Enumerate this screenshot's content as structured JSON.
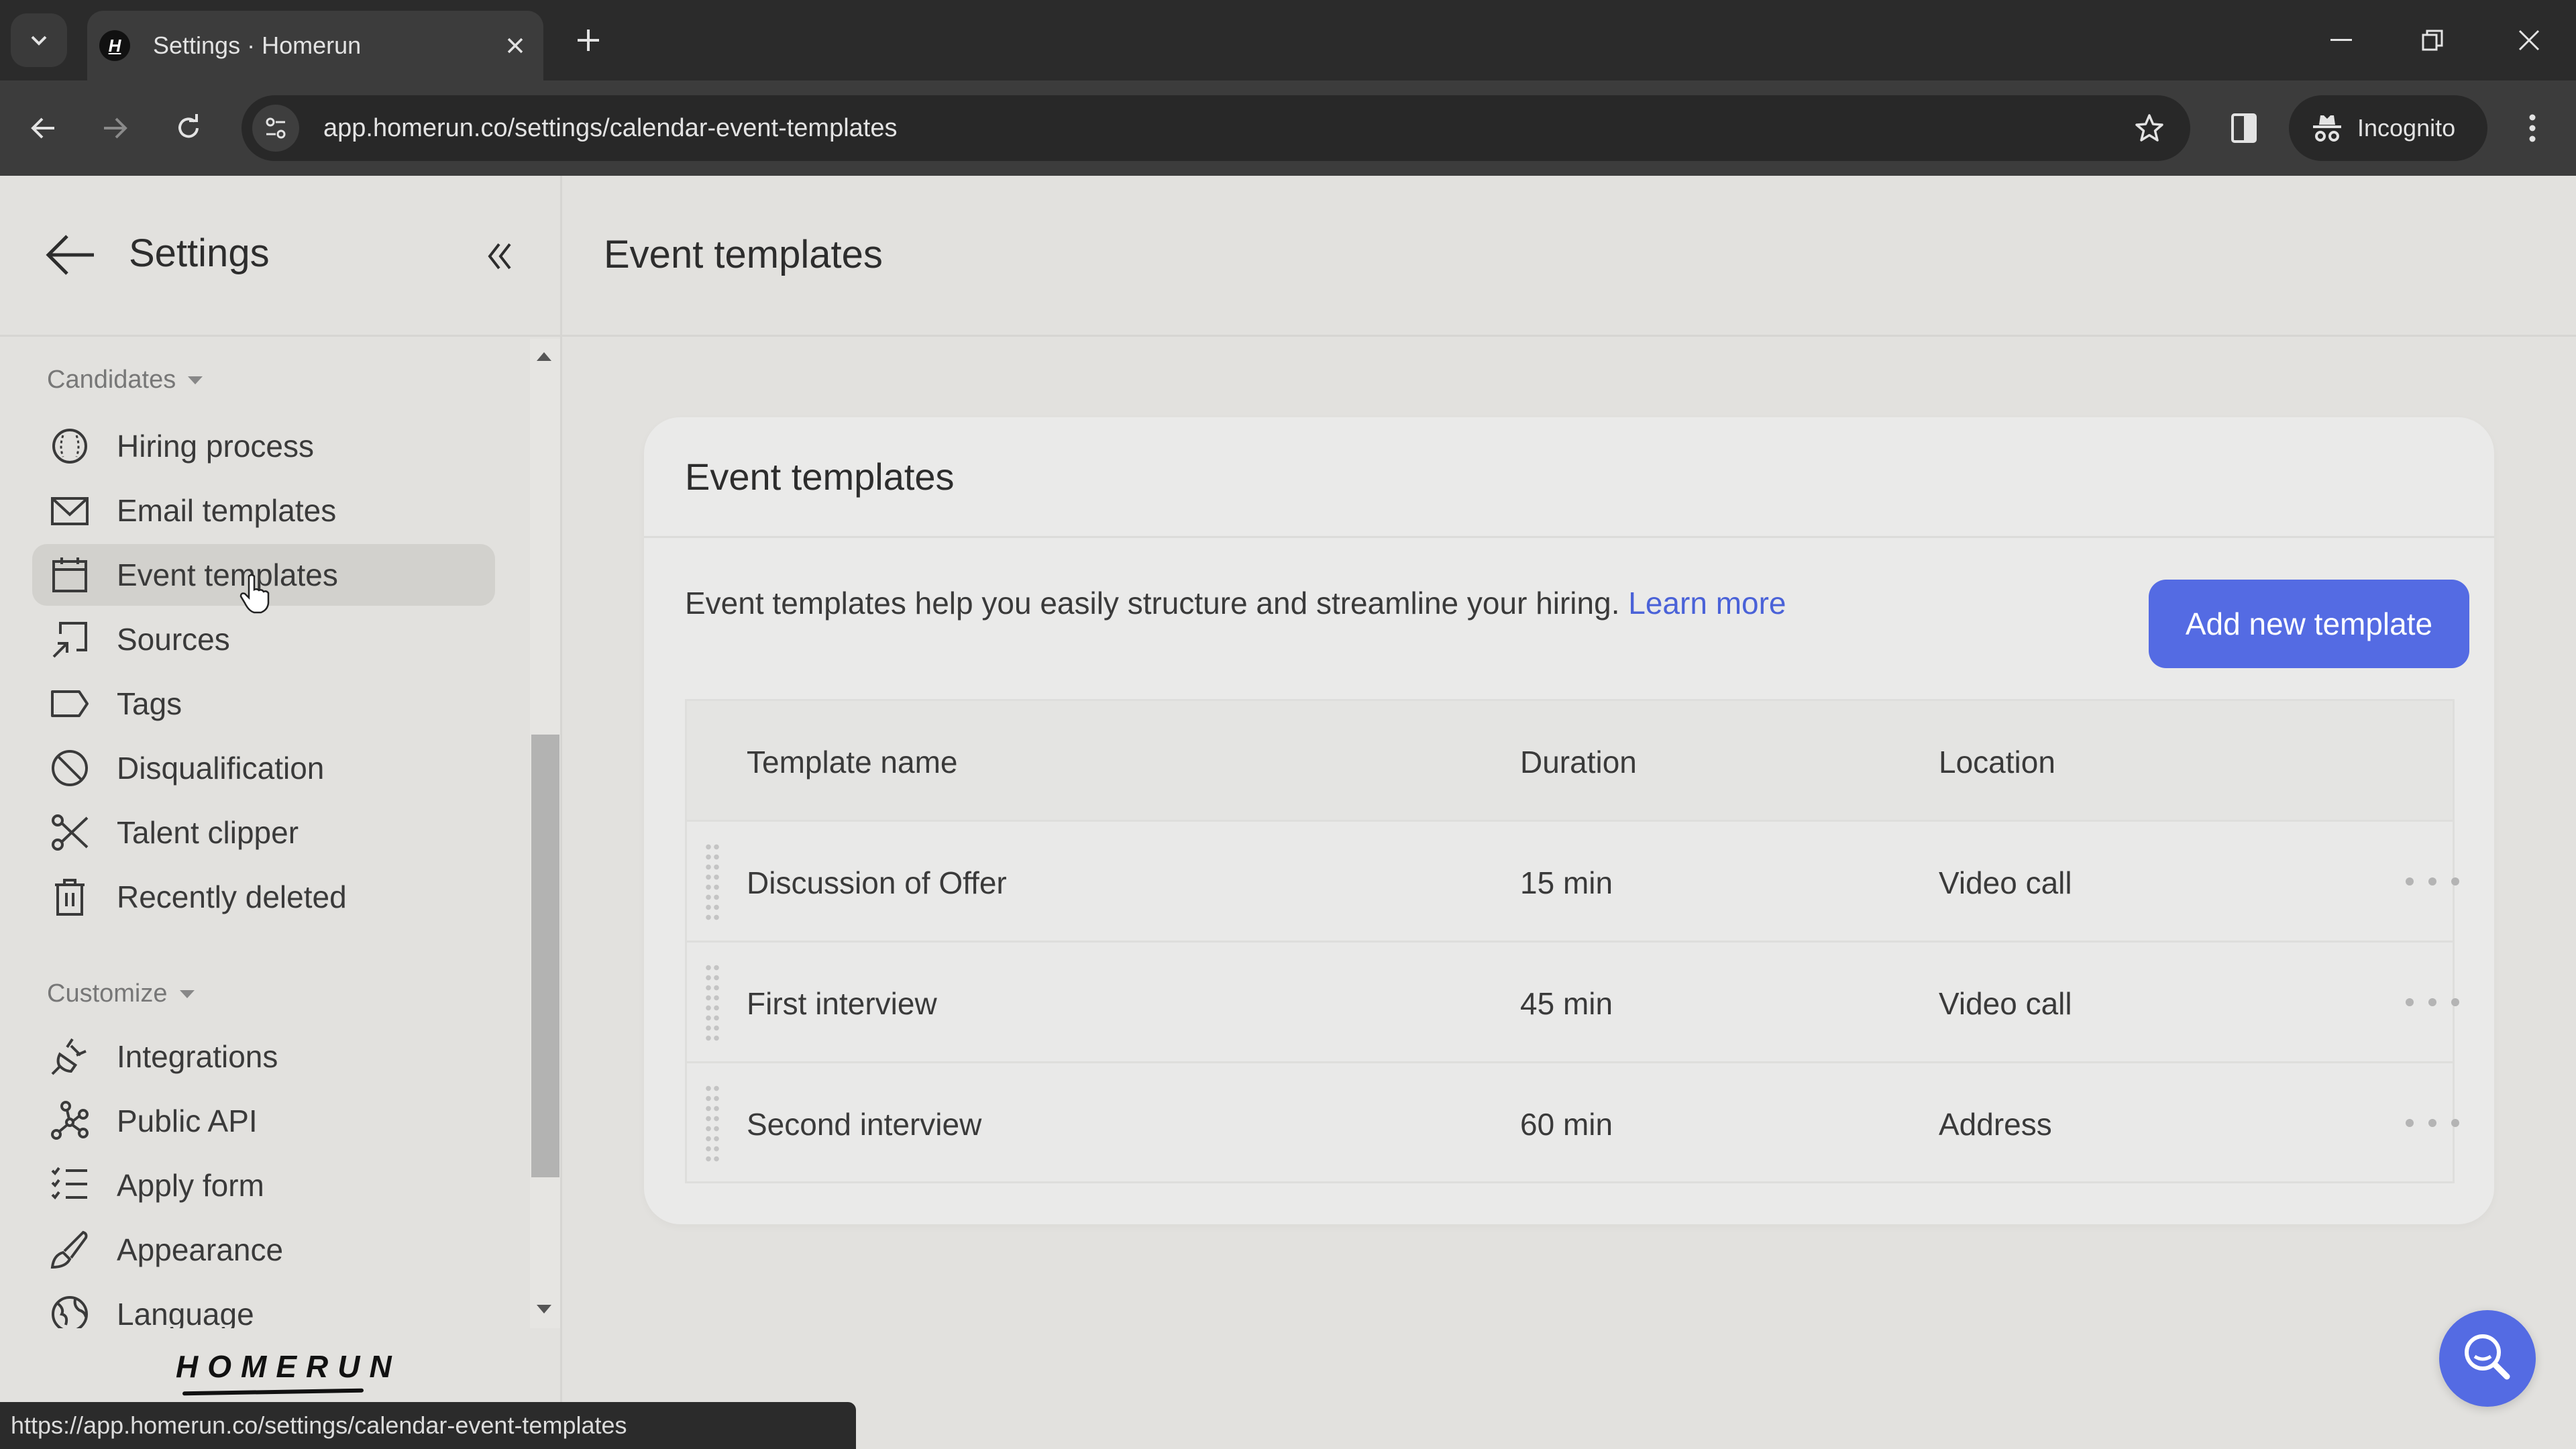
{
  "browser": {
    "tab_title": "Settings · Homerun",
    "favicon_letter": "H",
    "url": "app.homerun.co/settings/calendar-event-templates",
    "incognito_label": "Incognito",
    "status_url": "https://app.homerun.co/settings/calendar-event-templates"
  },
  "sidebar": {
    "title": "Settings",
    "groups": [
      {
        "label": "Candidates",
        "items": [
          {
            "label": "Hiring process",
            "icon": "baseball-icon"
          },
          {
            "label": "Email templates",
            "icon": "envelope-icon"
          },
          {
            "label": "Event templates",
            "icon": "calendar-icon",
            "active": true
          },
          {
            "label": "Sources",
            "icon": "sources-icon"
          },
          {
            "label": "Tags",
            "icon": "tag-icon"
          },
          {
            "label": "Disqualification",
            "icon": "ban-icon"
          },
          {
            "label": "Talent clipper",
            "icon": "scissors-icon"
          },
          {
            "label": "Recently deleted",
            "icon": "trash-icon"
          }
        ]
      },
      {
        "label": "Customize",
        "items": [
          {
            "label": "Integrations",
            "icon": "plug-icon"
          },
          {
            "label": "Public API",
            "icon": "network-icon"
          },
          {
            "label": "Apply form",
            "icon": "checklist-icon"
          },
          {
            "label": "Appearance",
            "icon": "brush-icon"
          },
          {
            "label": "Language",
            "icon": "globe-icon"
          }
        ]
      }
    ],
    "logo": "HOMERUN"
  },
  "main": {
    "page_title": "Event templates",
    "card": {
      "title": "Event templates",
      "description": "Event templates help you easily structure and streamline your hiring.",
      "learn_more": "Learn more",
      "add_button": "Add new template"
    },
    "table": {
      "columns": [
        "Template name",
        "Duration",
        "Location"
      ],
      "rows": [
        {
          "name": "Discussion of Offer",
          "duration": "15 min",
          "location": "Video call"
        },
        {
          "name": "First interview",
          "duration": "45 min",
          "location": "Video call"
        },
        {
          "name": "Second interview",
          "duration": "60 min",
          "location": "Address"
        }
      ]
    }
  },
  "colors": {
    "accent": "#546be3",
    "link": "#4a62d8",
    "background": "#e2e1de",
    "card": "#eaeae9",
    "chrome_dark": "#2b2b2b"
  }
}
